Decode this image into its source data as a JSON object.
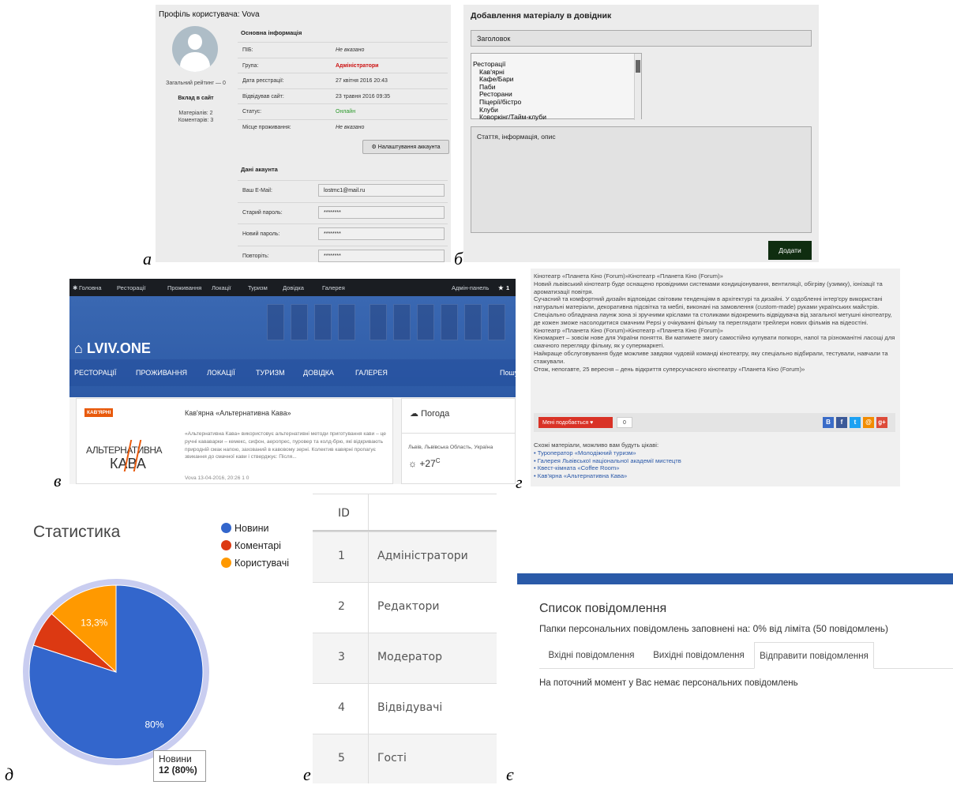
{
  "letters": {
    "a": "а",
    "b": "б",
    "v": "в",
    "g": "г",
    "d": "д",
    "e": "е",
    "ye": "є"
  },
  "profile": {
    "title": "Профіль користувача: Vova",
    "rating": "Загальний рейтинг — 0",
    "contrib_title": "Вклад в сайт",
    "materials": "Матеріалів: 2",
    "comments": "Коментарів: 3",
    "main_info": "Основна інформація",
    "rows": [
      {
        "k": "ПІБ:",
        "v": "Не вказано",
        "style": "it"
      },
      {
        "k": "Група:",
        "v": "Адміністратори",
        "style": "red"
      },
      {
        "k": "Дата реєстрації:",
        "v": "27 квітня 2016 20:43",
        "style": ""
      },
      {
        "k": "Відвідував сайт:",
        "v": "23 травня 2016 09:35",
        "style": ""
      },
      {
        "k": "Статус:",
        "v": "Онлайн",
        "style": "green"
      },
      {
        "k": "Місце проживання:",
        "v": "Не вказано",
        "style": "it"
      }
    ],
    "settings_btn": "Налаштування аккаунта",
    "account_title": "Дані акаунта",
    "fields": [
      {
        "k": "Ваш E-Mail:",
        "v": "lostmc1@mail.ru"
      },
      {
        "k": "Старий пароль:",
        "v": "********"
      },
      {
        "k": "Новий пароль:",
        "v": "********"
      },
      {
        "k": "Повторіть:",
        "v": "********"
      }
    ]
  },
  "add_material": {
    "title": "Добавлення матеріалу в довідник",
    "heading_placeholder": "Заголовок",
    "list_root": "Ресторації",
    "list_items": [
      "Кав'ярні",
      "Кафе/Бари",
      "Паби",
      "Ресторани",
      "Піцерії/бістро",
      "Клуби",
      "Коворкінг/Тайм-клуби"
    ],
    "body_placeholder": "Стаття, інформація, опис",
    "submit": "Додати"
  },
  "site": {
    "topnav": [
      "Головна",
      "Ресторації",
      "Проживання",
      "Локації",
      "Туризм",
      "Довідка",
      "Галерея"
    ],
    "admin": "Адмін-панель",
    "star": "1",
    "logo": "LVIV.ONE",
    "menu": [
      "РЕСТОРАЦІЇ",
      "ПРОЖИВАННЯ",
      "ЛОКАЦІЇ",
      "ТУРИЗМ",
      "ДОВІДКА",
      "ГАЛЕРЕЯ"
    ],
    "search_cut": "Пошу",
    "badge": "КАВ'ЯРНІ",
    "card_title": "Кав'ярна «Альтернативна Кава»",
    "card_desc": "«Альтернативна Кава» використовує альтернативні методи приготування кави – це ручні кававарки – кемекс, сифон, аеропрес, пуровер та колд-брю, які відкривають природній смак напою, захований в кавовому зерні. Колектив кавярні пропагує звикання до смачної кави і стверджує: Після...",
    "card_meta": "Vova   13-04-2016, 20:26   1   0",
    "logo_line1": "АЛЬТЕРНАТИВНА",
    "logo_line2": "КАВА",
    "weather_title": "Погода",
    "weather_loc": "Львів, Львівська Область, Україна",
    "weather_temp": "+27",
    "weather_unit": "C"
  },
  "article": {
    "lines": [
      "Кінотеатр «Планета Кіно (Forum)»Кінотеатр «Планета Кіно (Forum)»",
      "Новий львівський кінотеатр буде оснащено провідними системами кондиціонування, вентиляції, обігріву (узимку), іонізації та ароматизації повітря.",
      "Сучасний та комфортний дизайн відповідає світовим тенденціям в архітектурі та дизайні. У оздобленні інтер'єру використані натуральні матеріали, декоративна підсвітка та меблі, виконані на замовлення (custom-made) руками українських майстрів.",
      "Спеціально обладнана лаунж зона зі зручними кріслами та столиками відокремить відвідувача від загальної метушні кінотеатру, де кожен зможе насолодитися смачним Pepsi у очікуванні фільму та переглядати трейлери нових фільмів на відеостіні.",
      "Кінотеатр «Планета Кіно (Forum)»Кінотеатр «Планета Кіно (Forum)»",
      "Кіномаркет – зовсім нове для України поняття. Ви матимете змогу самостійно купувати попкорн, напої та різноманітні ласощі для смачного перегляду фільму, як у супермаркеті.",
      "Найкраще обслуговування буде можливе завдяки чудовій команді кінотеатру, яку спеціально відбирали, тестували, навчали та стажували.",
      "Отож, непогавте, 25 вересня – день відкриття суперсучасного кінотеатру «Планета Кіно (Forum)»"
    ],
    "like": "Мені подобається",
    "like_count": "0",
    "similar_title": "Схожі матеріали, можливо вам будуть цікаві:",
    "similar": [
      "Туроператор «Молодіжний туризм»",
      "Галерея Львівської національної академії мистецтв",
      "Квест-кімната «Coffee Room»",
      "Кав'ярна «Альтернативна Кава»"
    ]
  },
  "chart_data": {
    "type": "pie",
    "title": "Статистика",
    "labels": [
      "Новини",
      "Коментарі",
      "Користувачі"
    ],
    "values": [
      80,
      6.7,
      13.3
    ],
    "slice_labels": [
      "80%",
      "",
      "13,3%"
    ],
    "colors": [
      "#3366cc",
      "#dc3912",
      "#ff9900"
    ],
    "legend_position": "right",
    "tooltip_label": "Новини",
    "tooltip_value": "12 (80%)"
  },
  "groups": {
    "header_id": "ID",
    "rows": [
      {
        "id": "1",
        "name": "Адміністратори"
      },
      {
        "id": "2",
        "name": "Редактори"
      },
      {
        "id": "3",
        "name": "Модератор"
      },
      {
        "id": "4",
        "name": "Відвідувачі"
      },
      {
        "id": "5",
        "name": "Гості"
      }
    ]
  },
  "messages": {
    "title": "Список повідомлення",
    "subtitle": "Папки персональних повідомлень заповнені на: 0% від ліміта (50 повідомлень)",
    "tabs": [
      "Вхідні повідомлення",
      "Вихідні повідомлення",
      "Відправити повідомлення"
    ],
    "empty": "На поточний момент у Вас немає персональних повідомлень"
  }
}
